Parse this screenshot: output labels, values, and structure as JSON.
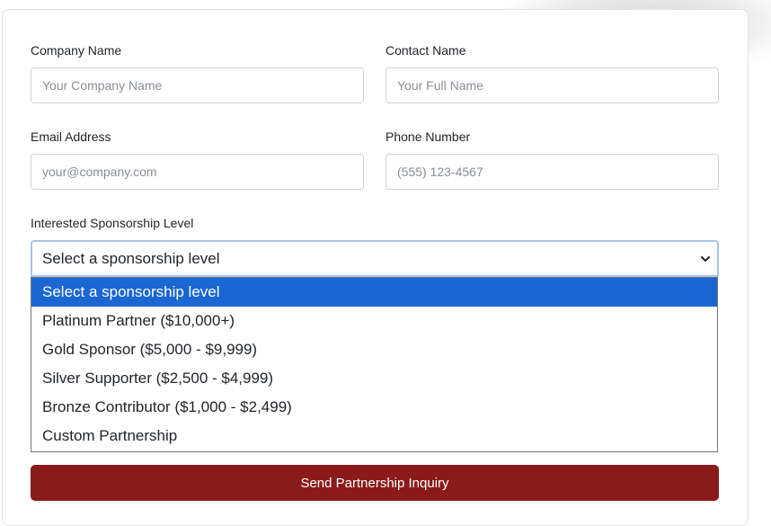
{
  "form": {
    "company": {
      "label": "Company Name",
      "placeholder": "Your Company Name"
    },
    "contact": {
      "label": "Contact Name",
      "placeholder": "Your Full Name"
    },
    "email": {
      "label": "Email Address",
      "placeholder": "your@company.com"
    },
    "phone": {
      "label": "Phone Number",
      "placeholder": "(555) 123-4567"
    },
    "sponsorship": {
      "label": "Interested Sponsorship Level",
      "selected": "Select a sponsorship level",
      "options": [
        "Select a sponsorship level",
        "Platinum Partner ($10,000+)",
        "Gold Sponsor ($5,000 - $9,999)",
        "Silver Supporter ($2,500 - $4,999)",
        "Bronze Contributor ($1,000 - $2,499)",
        "Custom Partnership"
      ],
      "highlighted_index": 0
    },
    "submit_label": "Send Partnership Inquiry"
  },
  "colors": {
    "submit_bg": "#8b1a1a",
    "highlight": "#1a66d2",
    "focus_border": "#a9c4ea"
  },
  "icons": {
    "select_arrow": "chevron-down-icon"
  }
}
